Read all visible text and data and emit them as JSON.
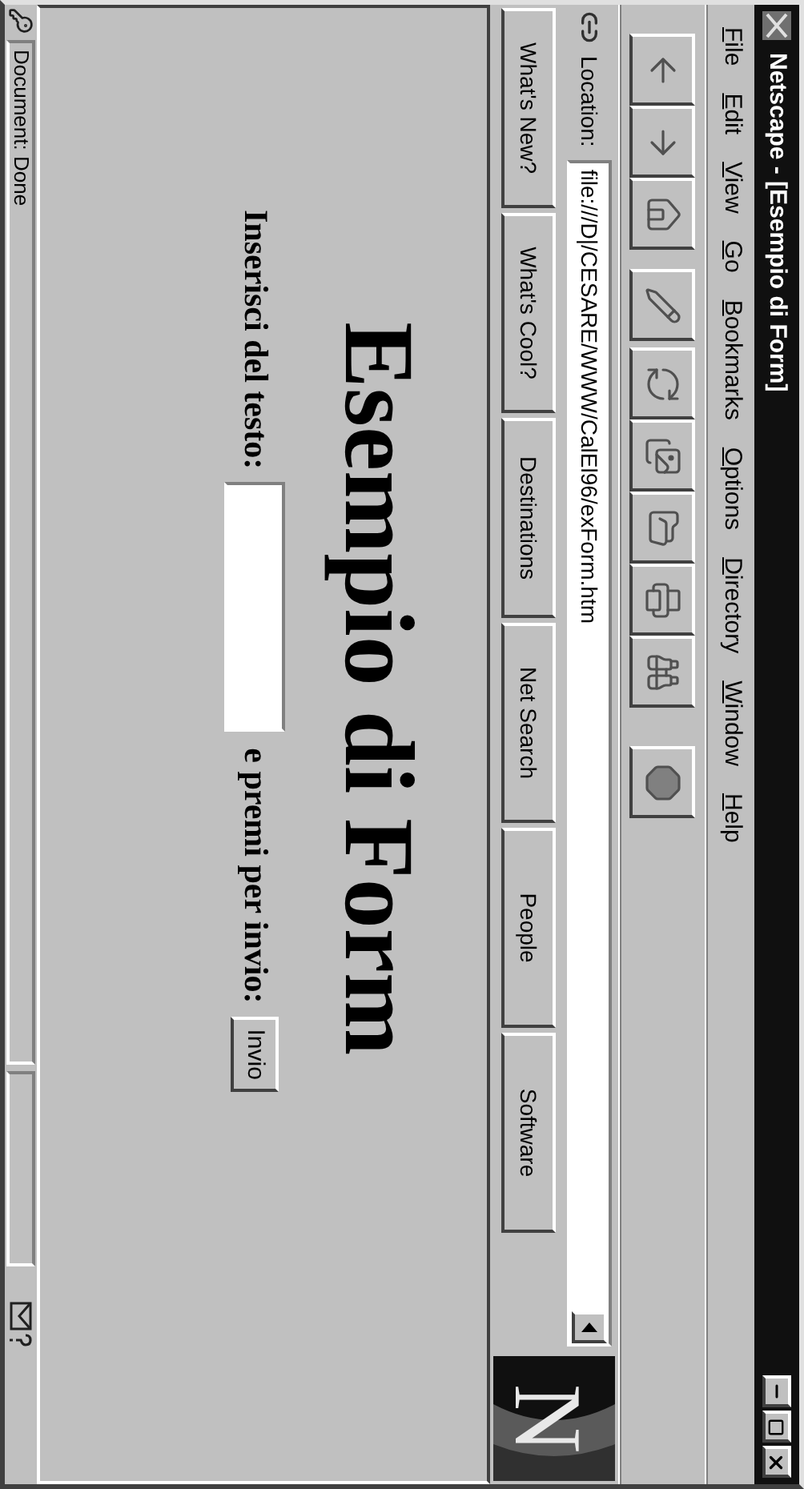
{
  "window": {
    "title": "Netscape - [Esempio di Form]"
  },
  "menu": [
    "File",
    "Edit",
    "View",
    "Go",
    "Bookmarks",
    "Options",
    "Directory",
    "Window",
    "Help"
  ],
  "location": {
    "label": "Location:",
    "value": "file:///D|/CESARE/WWW/CalEl96/exForm.htm"
  },
  "logo": {
    "letter": "N"
  },
  "directory_buttons": [
    "What's New?",
    "What's Cool?",
    "Destinations",
    "Net Search",
    "People",
    "Software"
  ],
  "page": {
    "heading": "Esempio di Form",
    "form": {
      "label": "Inserisci del testo:",
      "after_label": "e premi per invio:",
      "submit": "Invio"
    }
  },
  "status_bar": {
    "text": "Document: Done"
  }
}
